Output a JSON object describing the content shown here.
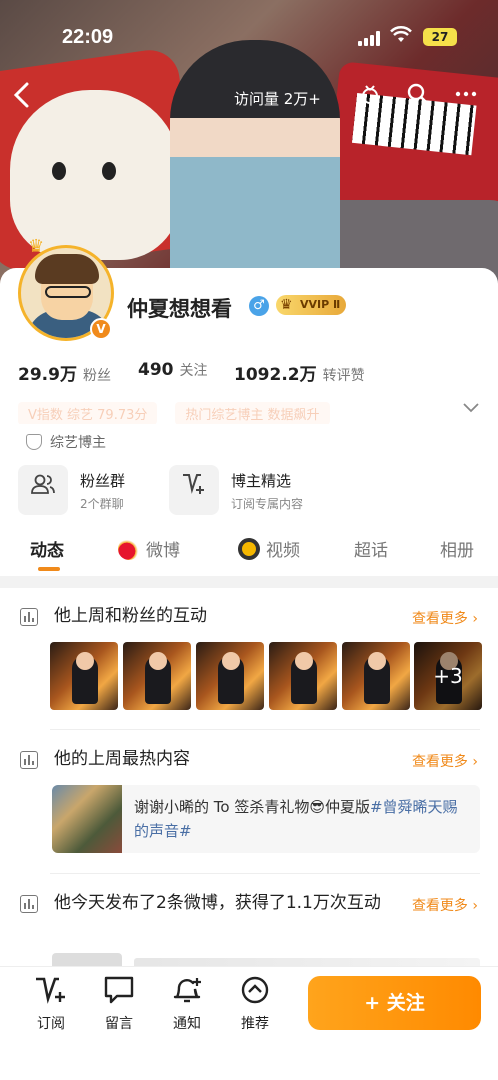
{
  "status_bar": {
    "time": "22:09",
    "battery": "27"
  },
  "nav": {
    "visits_label": "访问量 2万+"
  },
  "profile": {
    "name": "仲夏想想看",
    "vip_label": "VVIP Ⅱ",
    "verified_badge": "V",
    "stats": [
      {
        "value": "29.9万",
        "label": "粉丝"
      },
      {
        "value": "490",
        "label": "关注"
      },
      {
        "value": "1092.2万",
        "label": "转评赞"
      }
    ],
    "faded_tags": [
      "V指数 综艺 79.73分",
      "热门综艺博主 数据飙升"
    ],
    "tagline": "综艺博主"
  },
  "features": [
    {
      "title": "粉丝群",
      "subtitle": "2个群聊"
    },
    {
      "title": "博主精选",
      "subtitle": "订阅专属内容"
    }
  ],
  "tabs": [
    {
      "label": "动态"
    },
    {
      "label": "微博"
    },
    {
      "label": "视频"
    },
    {
      "label": "超话"
    },
    {
      "label": "相册"
    }
  ],
  "sections": {
    "interaction": {
      "title": "他上周和粉丝的互动",
      "more": "查看更多",
      "overflow_count": "+3"
    },
    "hot": {
      "title": "他的上周最热内容",
      "more": "查看更多",
      "text": "谢谢小晞的 To 签杀青礼物😎仲夏版",
      "hashtag": "#曾舜晞天赐的声音#"
    },
    "today": {
      "title": "他今天发布了2条微博，获得了1.1万次互动",
      "more": "查看更多"
    }
  },
  "bottom_bar": {
    "items": [
      {
        "label": "订阅",
        "icon": "subscribe-icon"
      },
      {
        "label": "留言",
        "icon": "message-icon"
      },
      {
        "label": "通知",
        "icon": "bell-plus-icon"
      },
      {
        "label": "推荐",
        "icon": "recommend-icon"
      }
    ],
    "follow_label": "+ 关注"
  },
  "colors": {
    "accent": "#f08a1b",
    "follow_button": "#ff9500",
    "link": "#4a6fa5"
  }
}
